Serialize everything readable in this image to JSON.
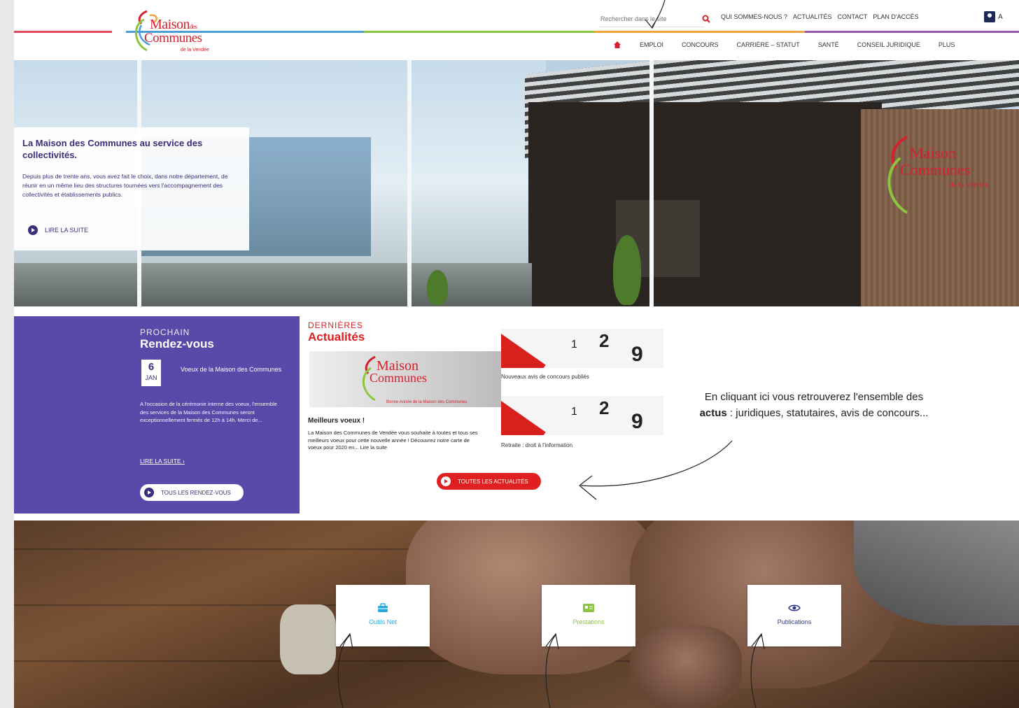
{
  "header": {
    "search_placeholder": "Rechercher dans le site",
    "top_links": [
      "QUI SOMMES-NOUS ?",
      "ACTUALITÉS",
      "CONTACT",
      "PLAN D'ACCÈS"
    ],
    "account_label": "A",
    "main_nav": [
      "EMPLOI",
      "CONCOURS",
      "CARRIÈRE – STATUT",
      "SANTÉ",
      "CONSEIL JURIDIQUE",
      "PLUS"
    ]
  },
  "logo": {
    "line1": "Maison",
    "line1_small": "des",
    "line2": "Communes",
    "line3": "de la Vendée"
  },
  "stripe_colors": [
    "#e2475b",
    "#4a9fd8",
    "#8cc63f",
    "#f2a541",
    "#9b59b6"
  ],
  "hero": {
    "title": "La Maison des Communes au service des collectivités.",
    "text": "Depuis plus de trente ans, vous avez fait le choix, dans notre département, de réunir en un même lieu des structures tournées vers l'accompagnement des collectivités et établissements publics.",
    "read_more": "LIRE LA SUITE"
  },
  "rdv": {
    "pre": "PROCHAIN",
    "title": "Rendez-vous",
    "day": "6",
    "month": "JAN",
    "event": "Voeux de la Maison des Communes",
    "desc": "A l'occasion de la cérémonie interne des voeux, l'ensemble des services de la Maison des Communes seront exceptionnellement fermés de 12h à 14h. Merci de...",
    "more": "LIRE LA SUITE  ›",
    "all_button": "TOUS LES RENDEZ-VOUS"
  },
  "actus": {
    "pre": "DERNIÈRES",
    "title": "Actualités",
    "img_caption": "Bonne Année de la Maison des Communes",
    "item1_title": "Meilleurs voeux !",
    "item1_text": "La Maison des Communes de Vendée vous souhaite à toutes et tous ses meilleurs voeux pour cette nouvelle année ! Découvrez notre carte de voeux pour 2020 en... Lire la suite",
    "cal_n1": "2",
    "cal_n2": "9",
    "cal_x": "1",
    "item2_title": "Nouveaux avis de concours publiés",
    "item3_title": "Retraite : droit à l'information",
    "all_button": "TOUTES LES ACTUALITÉS"
  },
  "annotation": {
    "pre": "En cliquant ici vous retrouverez l'ensemble des ",
    "bold": "actus",
    "post": " : juridiques, statutaires, avis de concours..."
  },
  "tiles": [
    {
      "label": "Outils Net",
      "color": "#29a8e0",
      "icon": "briefcase-icon"
    },
    {
      "label": "Prestations",
      "color": "#8cc63f",
      "icon": "card-icon"
    },
    {
      "label": "Publications",
      "color": "#2d3a8c",
      "icon": "eye-icon"
    }
  ],
  "colors": {
    "purple": "#5a49a8",
    "red": "#e02020",
    "navy": "#3a2f7a"
  }
}
